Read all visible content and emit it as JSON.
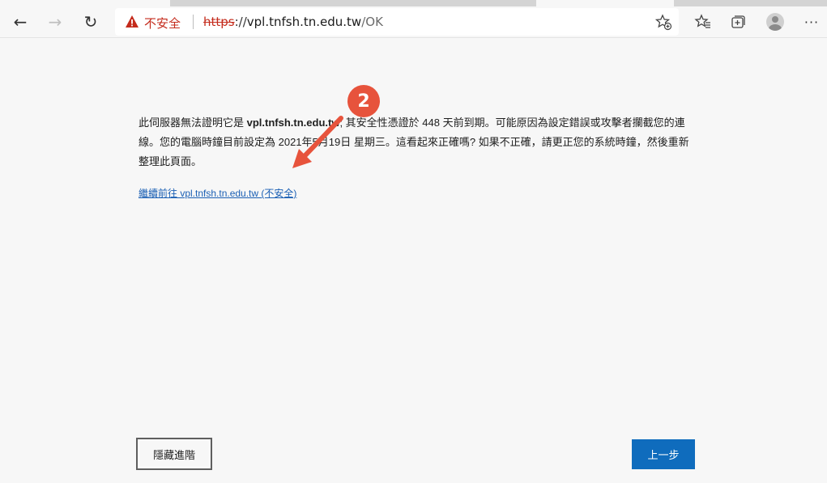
{
  "toolbar": {
    "back_icon": "←",
    "forward_icon": "→",
    "refresh_icon": "↻",
    "more_icon": "···"
  },
  "address_bar": {
    "security_label": "不安全",
    "url_scheme": "https",
    "url_separator": "://",
    "url_domain": "vpl.tnfsh.tn.edu.tw",
    "url_path": "/OK"
  },
  "warning": {
    "line_part1": "此伺服器無法證明它是 ",
    "domain": "vpl.tnfsh.tn.edu.tw",
    "line_part2": "; 其安全性憑證於 448 天前到期。可能原因為設定錯誤或攻擊者攔截您的連線。您的電腦時鐘目前設定為 2021年5月19日 星期三。這看起來正確嗎? 如果不正確，請更正您的系統時鐘，然後重新整理此頁面。",
    "proceed_link": "繼續前往 vpl.tnfsh.tn.edu.tw (不安全)"
  },
  "buttons": {
    "hide_advanced": "隱藏進階",
    "go_back": "上一步"
  },
  "annotation": {
    "step_number": "2",
    "color": "#e7533c"
  },
  "colors": {
    "accent": "#0f6cbd",
    "danger": "#c42b1c",
    "link": "#1a5fb4"
  }
}
